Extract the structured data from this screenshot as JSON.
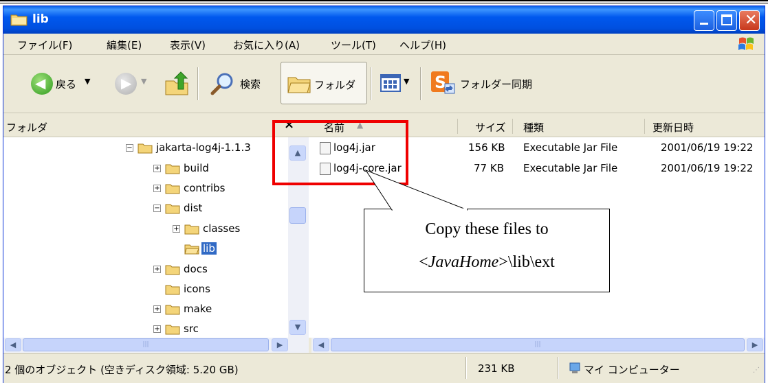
{
  "window": {
    "title": "lib"
  },
  "menu": [
    "ファイル(F)",
    "編集(E)",
    "表示(V)",
    "お気に入り(A)",
    "ツール(T)",
    "ヘルプ(H)"
  ],
  "toolbar": {
    "back": "戻る",
    "search": "検索",
    "folders": "フォルダ",
    "sync": "フォルダー同期"
  },
  "folders_pane": {
    "title": "フォルダ",
    "close_glyph": "×",
    "tree": [
      {
        "label": "jakarta-log4j-1.1.3",
        "expander": "⊟"
      },
      {
        "label": "build",
        "expander": "⊞"
      },
      {
        "label": "contribs",
        "expander": "⊞"
      },
      {
        "label": "dist",
        "expander": "⊟"
      },
      {
        "label": "classes",
        "expander": "⊞"
      },
      {
        "label": "lib",
        "expander": ""
      },
      {
        "label": "docs",
        "expander": "⊞"
      },
      {
        "label": "icons",
        "expander": ""
      },
      {
        "label": "make",
        "expander": "⊞"
      },
      {
        "label": "src",
        "expander": "⊞"
      }
    ]
  },
  "columns": {
    "name": "名前",
    "size": "サイズ",
    "type": "種類",
    "modified": "更新日時"
  },
  "files": [
    {
      "name": "log4j.jar",
      "size": "156 KB",
      "type": "Executable Jar File",
      "modified": "2001/06/19 19:22"
    },
    {
      "name": "log4j-core.jar",
      "size": "77 KB",
      "type": "Executable Jar File",
      "modified": "2001/06/19 19:22"
    }
  ],
  "status": {
    "objects": "2 個のオブジェクト (空きディスク領域: 5.20 GB)",
    "size": "231 KB",
    "location": "マイ コンピューター"
  },
  "callout": {
    "line1": "Copy these files to",
    "line2_prefix": "<",
    "line2_italic": "JavaHome",
    "line2_suffix": ">\\lib\\ext"
  },
  "colors": {
    "title_bar": "#0058ee",
    "selection": "#316ac5",
    "highlight_box": "#ef0000"
  }
}
